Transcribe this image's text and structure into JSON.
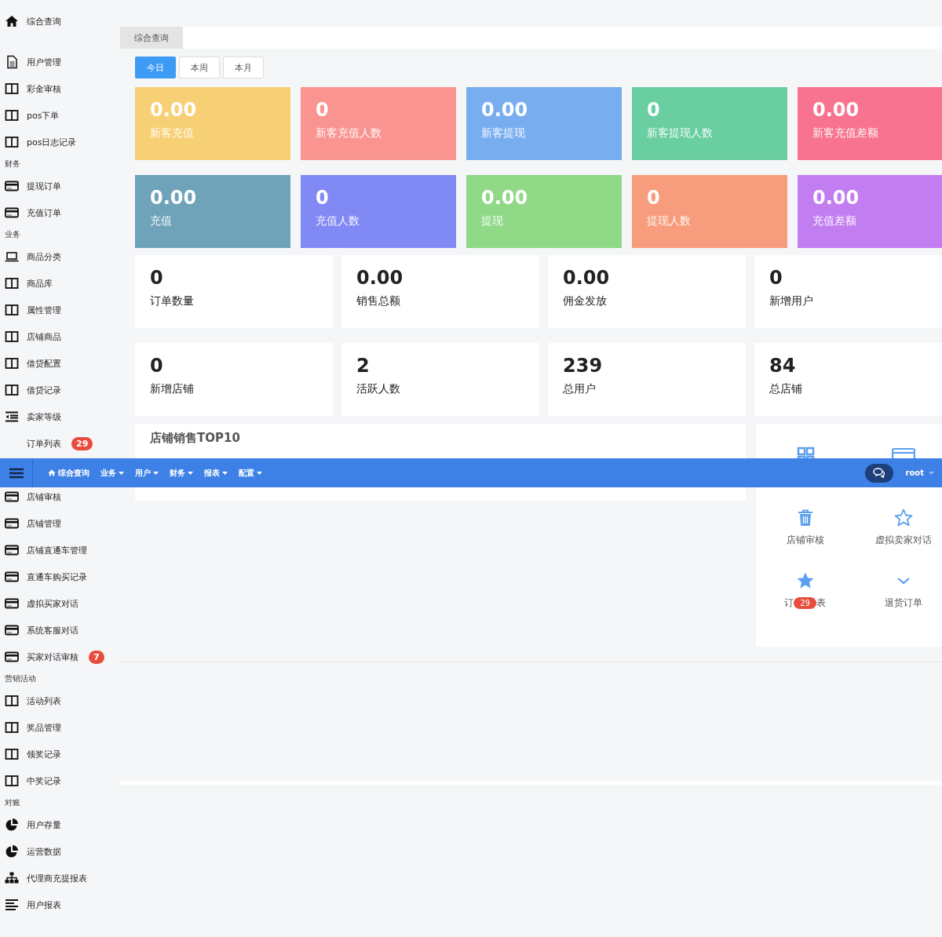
{
  "sidebar": {
    "groups": [
      [
        {
          "kind": "home",
          "label": "综合查询"
        }
      ],
      [
        {
          "kind": "doc",
          "label": "用户管理"
        },
        {
          "kind": "columns",
          "label": "彩金审核"
        },
        {
          "kind": "columns",
          "label": "pos下单"
        },
        {
          "kind": "columns",
          "label": "pos日志记录"
        },
        {
          "kind": "section",
          "label": "财务"
        },
        {
          "kind": "card",
          "label": "提现订单"
        },
        {
          "kind": "card",
          "label": "充值订单"
        },
        {
          "kind": "section",
          "label": "业务"
        },
        {
          "kind": "laptop",
          "label": "商品分类"
        },
        {
          "kind": "columns",
          "label": "商品库"
        },
        {
          "kind": "columns",
          "label": "属性管理"
        },
        {
          "kind": "columns",
          "label": "店铺商品"
        },
        {
          "kind": "columns",
          "label": "借贷配置"
        },
        {
          "kind": "columns",
          "label": "借贷记录"
        },
        {
          "kind": "indent",
          "label": "卖家等级"
        },
        {
          "kind": "plain",
          "label": "订单列表",
          "badge": "29"
        }
      ],
      [
        {
          "kind": "card",
          "label": "店铺审核"
        },
        {
          "kind": "card",
          "label": "店铺管理"
        },
        {
          "kind": "card",
          "label": "店铺直通车管理"
        },
        {
          "kind": "card",
          "label": "直通车购买记录"
        },
        {
          "kind": "card",
          "label": "虚拟买家对话"
        },
        {
          "kind": "card",
          "label": "系统客服对话"
        },
        {
          "kind": "card",
          "label": "买家对话审核",
          "badge": "7"
        },
        {
          "kind": "section",
          "label": "营销活动"
        },
        {
          "kind": "columns",
          "label": "活动列表"
        },
        {
          "kind": "columns",
          "label": "奖品管理"
        },
        {
          "kind": "columns",
          "label": "领奖记录"
        },
        {
          "kind": "columns",
          "label": "中奖记录"
        },
        {
          "kind": "section",
          "label": "对账"
        },
        {
          "kind": "pie",
          "label": "用户存量"
        },
        {
          "kind": "pie",
          "label": "运营数据"
        },
        {
          "kind": "sitemap",
          "label": "代理商充提报表"
        },
        {
          "kind": "lines",
          "label": "用户报表"
        }
      ]
    ]
  },
  "page_tabs": [
    {
      "label": "综合查询",
      "selected": true
    }
  ],
  "period_buttons": [
    {
      "label": "今日",
      "selected": true
    },
    {
      "label": "本周",
      "selected": false
    },
    {
      "label": "本月",
      "selected": false
    }
  ],
  "color_cards": [
    {
      "value": "0.00",
      "label": "新客充值",
      "color": "#f7cf74"
    },
    {
      "value": "0",
      "label": "新客充值人数",
      "color": "#f99490"
    },
    {
      "value": "0.00",
      "label": "新客提现",
      "color": "#78aef0"
    },
    {
      "value": "0",
      "label": "新客提现人数",
      "color": "#69cea0"
    },
    {
      "value": "0.00",
      "label": "新客充值差额",
      "color": "#f7738f"
    },
    {
      "value": "0.00",
      "label": "充值",
      "color": "#6fa3b9"
    },
    {
      "value": "0",
      "label": "充值人数",
      "color": "#8189f5"
    },
    {
      "value": "0.00",
      "label": "提现",
      "color": "#8fd987"
    },
    {
      "value": "0",
      "label": "提现人数",
      "color": "#f79c7c"
    },
    {
      "value": "0.00",
      "label": "充值差额",
      "color": "#c27ef0"
    }
  ],
  "stat_cards": [
    {
      "value": "0",
      "label": "订单数量"
    },
    {
      "value": "0.00",
      "label": "销售总额"
    },
    {
      "value": "0.00",
      "label": "佣金发放"
    },
    {
      "value": "0",
      "label": "新增用户"
    },
    {
      "value": "0",
      "label": "新增店铺"
    },
    {
      "value": "2",
      "label": "活跃人数"
    },
    {
      "value": "239",
      "label": "总用户"
    },
    {
      "value": "84",
      "label": "总店铺"
    }
  ],
  "sales_panel": {
    "title": "店铺销售TOP10"
  },
  "quick_links": [
    {
      "kind": "grid"
    },
    {
      "kind": "window"
    },
    {
      "kind": "trash",
      "label": "店铺审核"
    },
    {
      "kind": "star-outline",
      "label": "虚拟卖家对话"
    },
    {
      "kind": "star",
      "label_start": "订",
      "badge": "29",
      "label_end": "表"
    },
    {
      "kind": "chevron",
      "label": "退货订单"
    }
  ],
  "top_nav": {
    "home_item": "综合查询",
    "menu": [
      "业务",
      "用户",
      "财务",
      "报表",
      "配置"
    ],
    "user": "root"
  }
}
